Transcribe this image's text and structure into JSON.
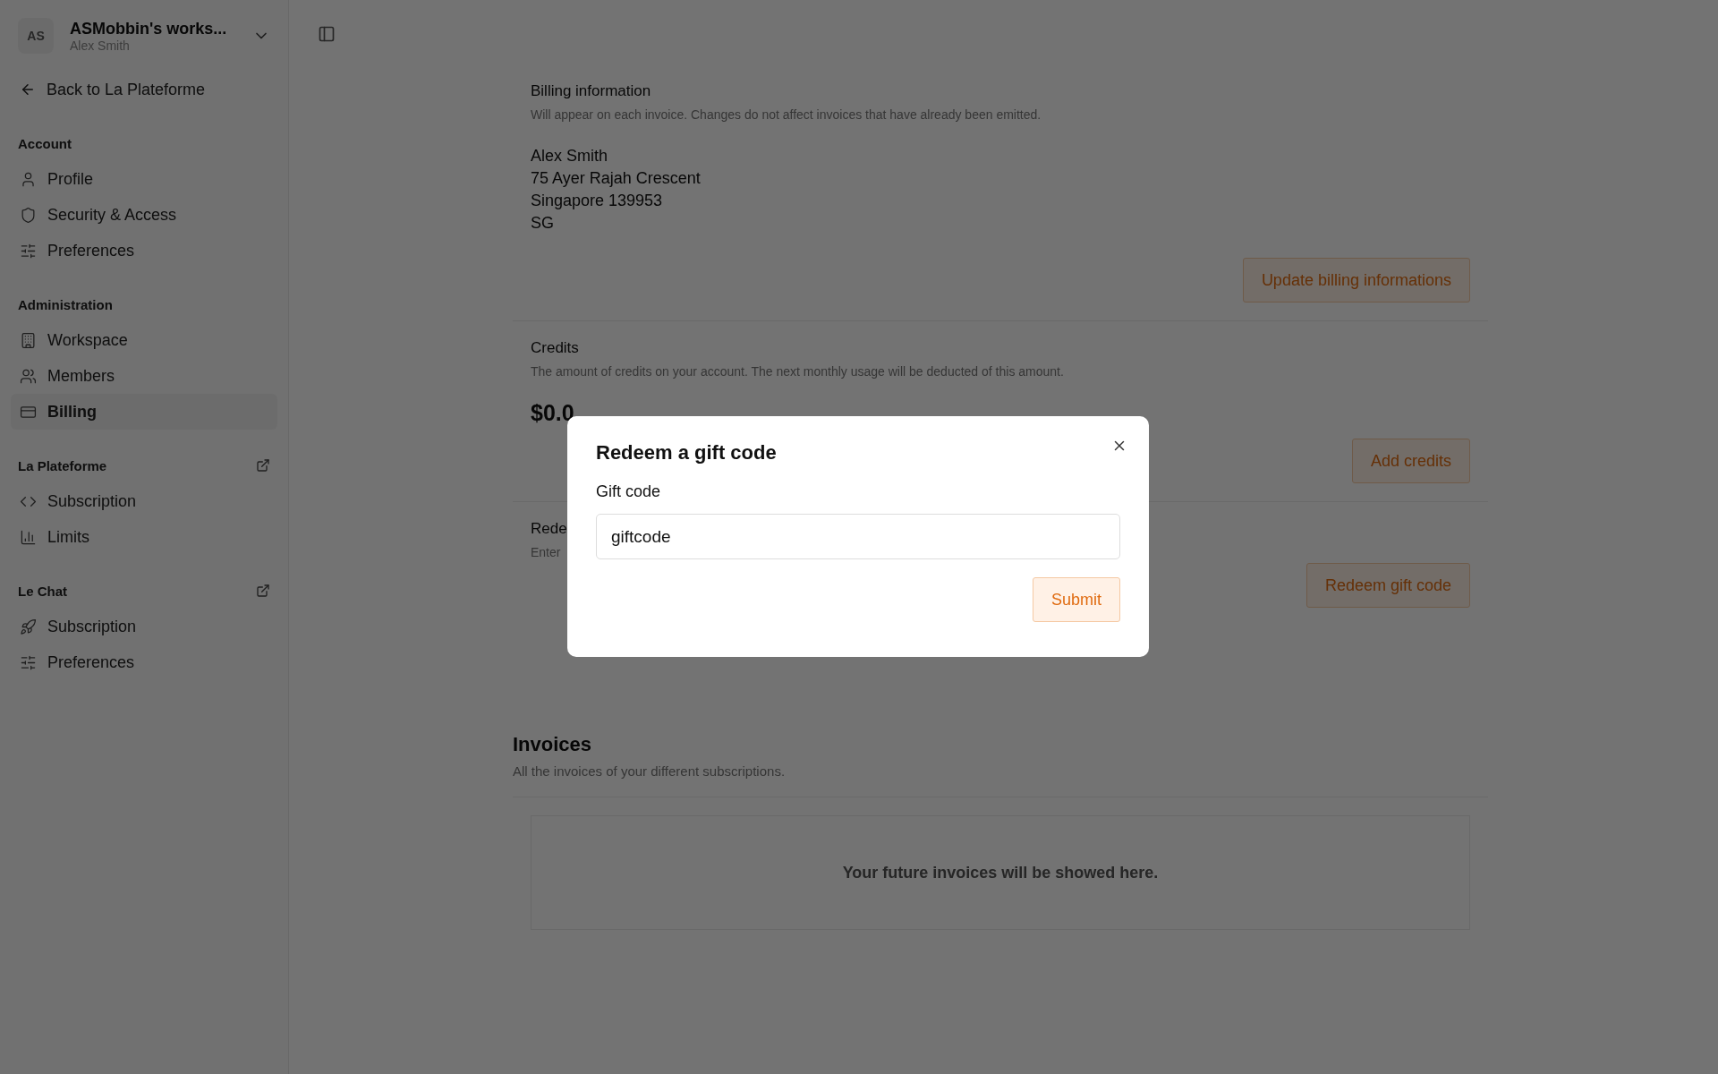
{
  "workspace": {
    "initials": "AS",
    "name": "ASMobbin's works...",
    "user": "Alex Smith"
  },
  "back_link": "Back to La Plateforme",
  "sidebar": {
    "sections": [
      {
        "title": "Account",
        "external_link": false,
        "items": [
          {
            "label": "Profile",
            "selected": false
          },
          {
            "label": "Security & Access",
            "selected": false
          },
          {
            "label": "Preferences",
            "selected": false
          }
        ]
      },
      {
        "title": "Administration",
        "external_link": false,
        "items": [
          {
            "label": "Workspace",
            "selected": false
          },
          {
            "label": "Members",
            "selected": false
          },
          {
            "label": "Billing",
            "selected": true
          }
        ]
      },
      {
        "title": "La Plateforme",
        "external_link": true,
        "items": [
          {
            "label": "Subscription",
            "selected": false
          },
          {
            "label": "Limits",
            "selected": false
          }
        ]
      },
      {
        "title": "Le Chat",
        "external_link": true,
        "items": [
          {
            "label": "Subscription",
            "selected": false
          },
          {
            "label": "Preferences",
            "selected": false
          }
        ]
      }
    ]
  },
  "billing_information": {
    "title": "Billing information",
    "description": "Will appear on each invoice. Changes do not affect invoices that have already been emitted.",
    "address": [
      "Alex Smith",
      "75 Ayer Rajah Crescent",
      "Singapore 139953",
      "SG"
    ],
    "button": "Update billing informations"
  },
  "credits": {
    "title": "Credits",
    "description": "The amount of credits on your account. The next monthly usage will be deducted of this amount.",
    "amount": "$0.0",
    "button": "Add credits"
  },
  "redeem": {
    "title": "Rede",
    "description": "Enter",
    "button": "Redeem gift code"
  },
  "invoices": {
    "title": "Invoices",
    "description": "All the invoices of your different subscriptions.",
    "empty_message": "Your future invoices will be showed here."
  },
  "modal": {
    "title": "Redeem a gift code",
    "field_label": "Gift code",
    "value": "giftcode",
    "submit": "Submit"
  }
}
